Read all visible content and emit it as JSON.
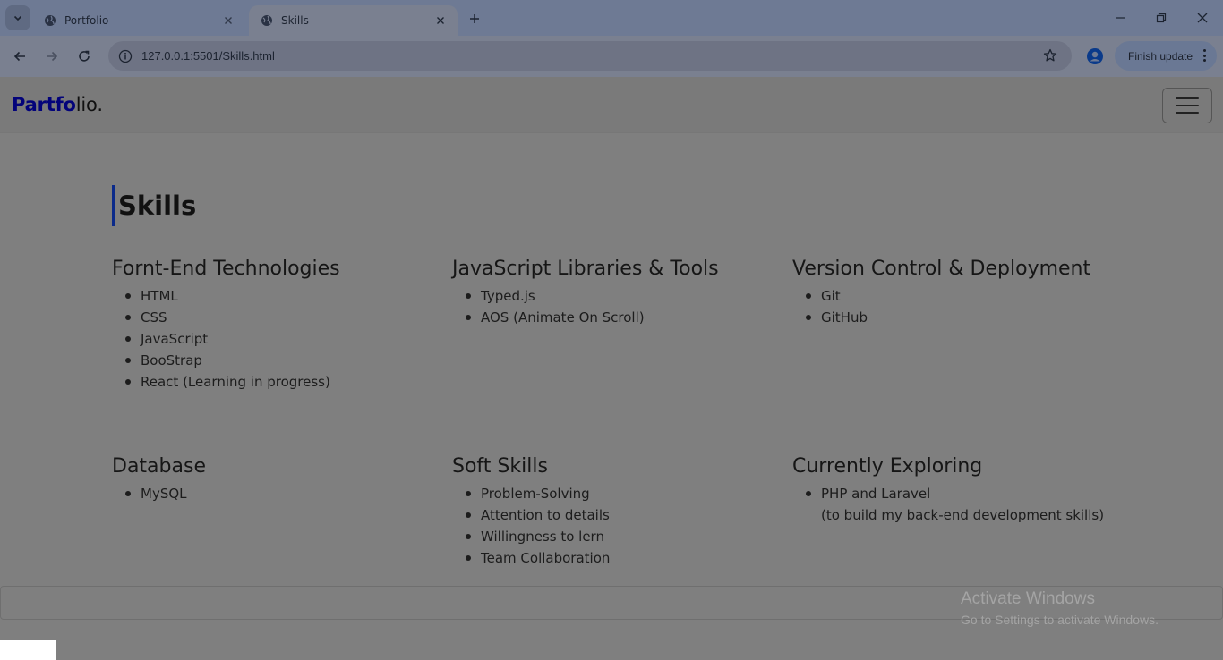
{
  "browser": {
    "tabs": [
      {
        "title": "Portfolio",
        "active": false
      },
      {
        "title": "Skills",
        "active": true
      }
    ],
    "url": "127.0.0.1:5501/Skills.html",
    "update_label": "Finish update"
  },
  "navbar": {
    "brand_bold": "Partfo",
    "brand_rest": "lio."
  },
  "page": {
    "title": "Skills",
    "groups": [
      {
        "heading": "Fornt-End Technologies",
        "items": [
          "HTML",
          "CSS",
          "JavaScript",
          "BooStrap",
          "React (Learning in progress)"
        ]
      },
      {
        "heading": "JavaScript Libraries & Tools",
        "items": [
          "Typed.js",
          "AOS (Animate On Scroll)"
        ]
      },
      {
        "heading": "Version Control & Deployment",
        "items": [
          "Git",
          "GitHub"
        ]
      },
      {
        "heading": "Database",
        "items": [
          "MySQL"
        ]
      },
      {
        "heading": "Soft Skills",
        "items": [
          "Problem-Solving",
          "Attention to details",
          "Willingness to lern",
          "Team Collaboration"
        ]
      },
      {
        "heading": "Currently Exploring",
        "items": [
          "PHP and Laravel\n(to build my back-end development skills)"
        ]
      }
    ]
  },
  "watermark": {
    "line1": "Activate Windows",
    "line2": "Go to Settings to activate Windows."
  },
  "colors": {
    "brand_accent": "#03037a",
    "title_border": "#0b2a8a"
  }
}
